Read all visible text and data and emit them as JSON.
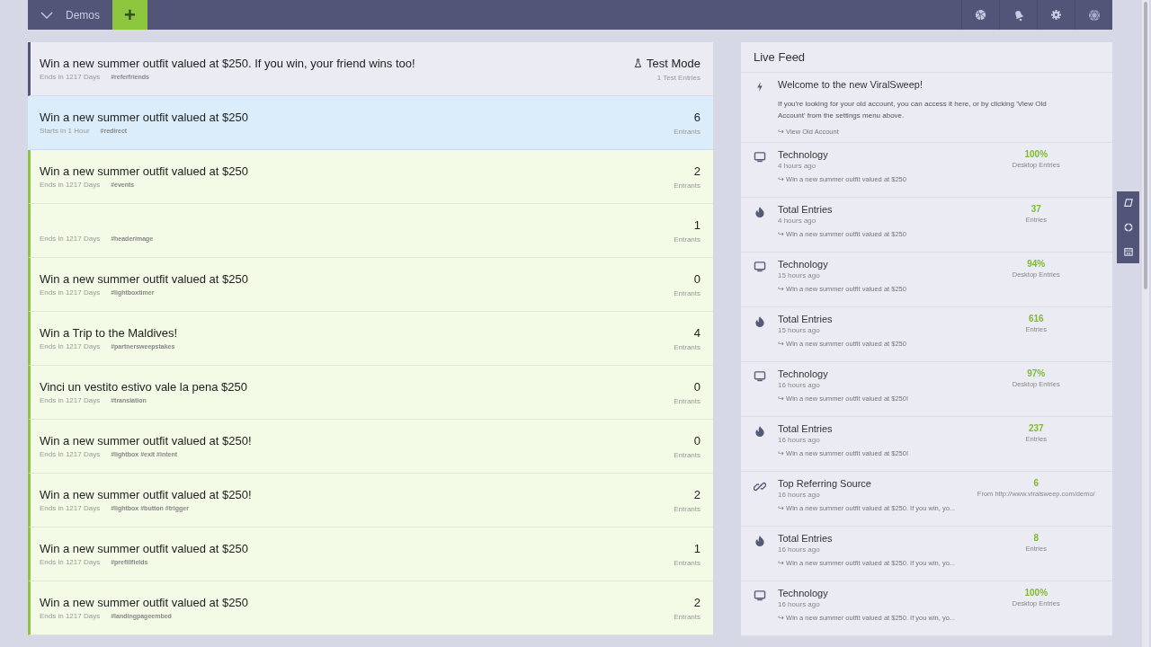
{
  "topbar": {
    "menu_label": "Demos",
    "add_button": "+"
  },
  "campaigns": [
    {
      "kind": "test",
      "title": "Win a new summer outfit valued at $250. If you win, your friend wins too!",
      "timing": "Ends in 1217 Days",
      "tags": "#referfriends",
      "count": "Test Mode",
      "count_label": "1 Test Entries"
    },
    {
      "kind": "scheduled",
      "title": "Win a new summer outfit valued at $250",
      "timing": "Starts in 1 Hour",
      "tags": "#redirect",
      "count": "6",
      "count_label": "Entrants"
    },
    {
      "kind": "live",
      "title": "Win a new summer outfit valued at $250",
      "timing": "Ends in 1217 Days",
      "tags": "#events",
      "count": "2",
      "count_label": "Entrants"
    },
    {
      "kind": "live",
      "timing": "Ends in 1217 Days",
      "tags": "#headerimage",
      "count": "1",
      "count_label": "Entrants"
    },
    {
      "kind": "live",
      "title": "Win a new summer outfit valued at $250",
      "timing": "Ends in 1217 Days",
      "tags": "#lightboxtimer",
      "count": "0",
      "count_label": "Entrants"
    },
    {
      "kind": "live",
      "title": "Win a Trip to the Maldives!",
      "timing": "Ends in 1217 Days",
      "tags": "#partnersweepstakes",
      "count": "4",
      "count_label": "Entrants"
    },
    {
      "kind": "live",
      "title": "Vinci un vestito estivo vale la pena $250",
      "timing": "Ends in 1217 Days",
      "tags": "#translation",
      "count": "0",
      "count_label": "Entrants"
    },
    {
      "kind": "live",
      "title": "Win a new summer outfit valued at $250!",
      "timing": "Ends in 1217 Days",
      "tags": "#lightbox #exit #intent",
      "count": "0",
      "count_label": "Entrants"
    },
    {
      "kind": "live",
      "title": "Win a new summer outfit valued at $250!",
      "timing": "Ends in 1217 Days",
      "tags": "#lightbox #button #trigger",
      "count": "2",
      "count_label": "Entrants"
    },
    {
      "kind": "live",
      "title": "Win a new summer outfit valued at $250",
      "timing": "Ends in 1217 Days",
      "tags": "#prefillfields",
      "count": "1",
      "count_label": "Entrants"
    },
    {
      "kind": "live",
      "title": "Win a new summer outfit valued at $250",
      "timing": "Ends in 1217 Days",
      "tags": "#landingpageembed",
      "count": "2",
      "count_label": "Entrants"
    }
  ],
  "live_feed": {
    "title": "Live Feed",
    "welcome": {
      "title": "Welcome to the new ViralSweep!",
      "text": "If you're looking for your old account, you can access it here, or by clicking 'View Old Account' from the settings menu above.",
      "link": "↪ View Old Account"
    },
    "items": [
      {
        "kind": "technology",
        "title": "Technology",
        "time": "4 hours ago",
        "campaign": "↪ Win a new summer outfit valued at $250",
        "value": "100%",
        "value_label": "Desktop Entries"
      },
      {
        "kind": "entries",
        "title": "Total Entries",
        "time": "4 hours ago",
        "campaign": "↪ Win a new summer outfit valued at $250",
        "value": "37",
        "value_label": "Entries"
      },
      {
        "kind": "technology",
        "title": "Technology",
        "time": "15 hours ago",
        "campaign": "↪ Win a new summer outfit valued at $250",
        "value": "94%",
        "value_label": "Desktop Entries"
      },
      {
        "kind": "entries",
        "title": "Total Entries",
        "time": "15 hours ago",
        "campaign": "↪ Win a new summer outfit valued at $250",
        "value": "616",
        "value_label": "Entries"
      },
      {
        "kind": "technology",
        "title": "Technology",
        "time": "16 hours ago",
        "campaign": "↪ Win a new summer outfit valued at $250!",
        "value": "97%",
        "value_label": "Desktop Entries"
      },
      {
        "kind": "entries",
        "title": "Total Entries",
        "time": "16 hours ago",
        "campaign": "↪ Win a new summer outfit valued at $250!",
        "value": "237",
        "value_label": "Entries"
      },
      {
        "kind": "referral",
        "title": "Top Referring Source",
        "time": "16 hours ago",
        "campaign": "↪ Win a new summer outfit valued at $250. If you win, yo...",
        "value": "6",
        "value_label": "From http://www.viralsweep.com/demo/"
      },
      {
        "kind": "entries",
        "title": "Total Entries",
        "time": "16 hours ago",
        "campaign": "↪ Win a new summer outfit valued at $250. If you win, yo...",
        "value": "8",
        "value_label": "Entries"
      },
      {
        "kind": "technology",
        "title": "Technology",
        "time": "16 hours ago",
        "campaign": "↪ Win a new summer outfit valued at $250. If you win, yo...",
        "value": "100%",
        "value_label": "Desktop Entries"
      }
    ]
  }
}
